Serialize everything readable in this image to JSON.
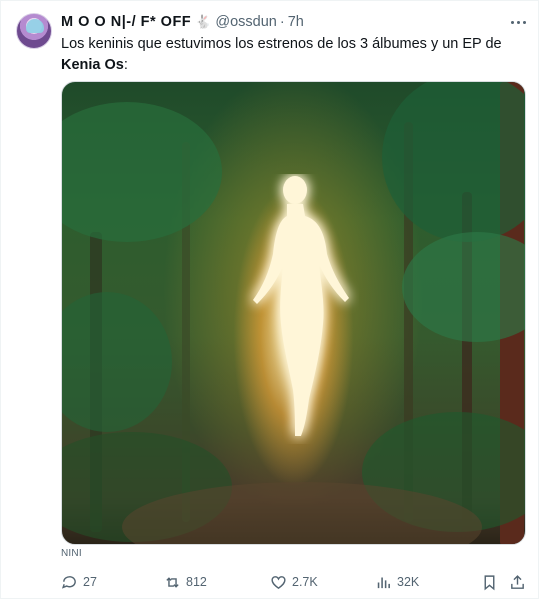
{
  "tweet": {
    "author_name": "M O O N|-/ F* OFF",
    "author_badge_icon": "rabbit-icon",
    "handle": "@ossdun",
    "separator": "·",
    "time": "7h",
    "text_plain": "Los keninis que estuvimos los estrenos de los 3 álbumes y un EP de ",
    "text_bold": "Kenia Os",
    "text_end": ":",
    "media_alt_label": "NINI"
  },
  "actions": {
    "replies": "27",
    "retweets": "812",
    "likes": "2.7K",
    "views": "32K"
  },
  "colors": {
    "text": "#0f1419",
    "secondary": "#536471",
    "border": "#eff3f4"
  }
}
